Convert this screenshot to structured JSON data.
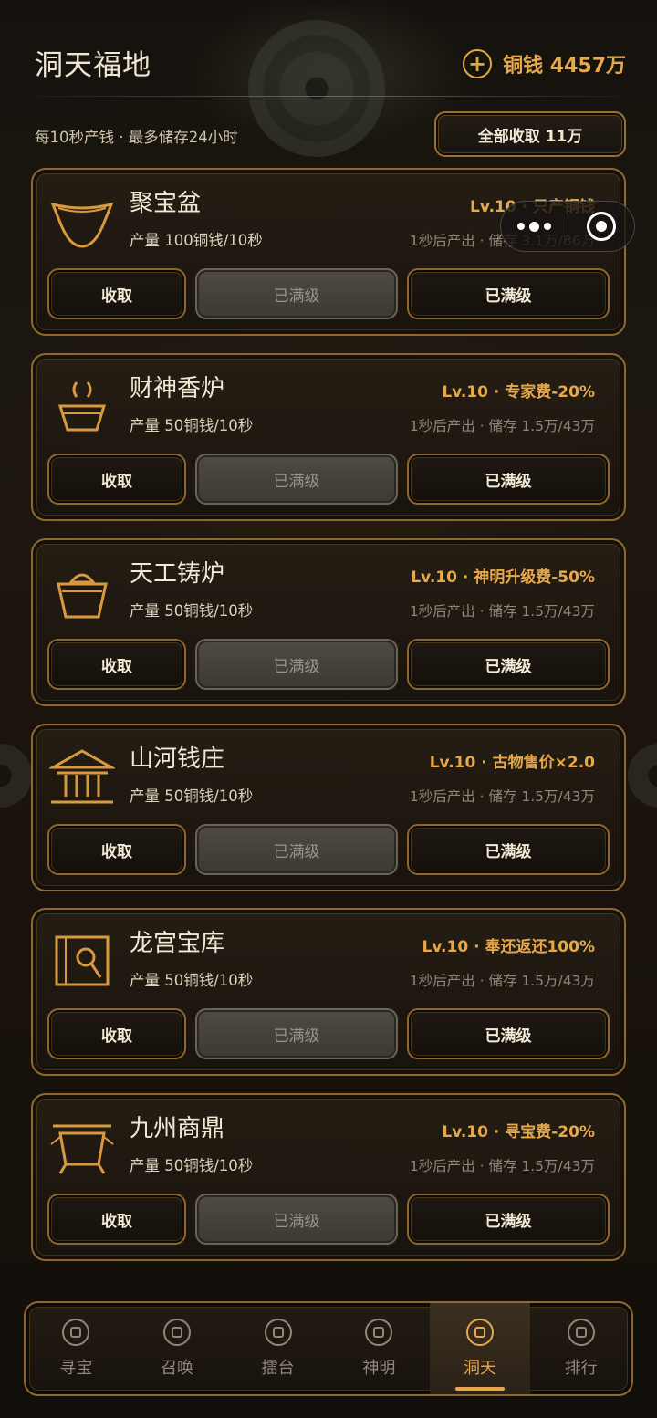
{
  "header": {
    "title": "洞天福地",
    "coins": "铜钱 4457万",
    "subtitle": "每10秒产钱 · 最多储存24小时",
    "collect_all_label": "全部收取 11万"
  },
  "cards": [
    {
      "name": "聚宝盆",
      "output": "产量 100铜钱/10秒",
      "level": "Lv.10 · 只产铜钱",
      "storage": "1秒后产出 · 储存 3.1万/86万",
      "icon": "treasure-bowl-icon"
    },
    {
      "name": "财神香炉",
      "output": "产量 50铜钱/10秒",
      "level": "Lv.10 · 专家费-20%",
      "storage": "1秒后产出 · 储存 1.5万/43万",
      "icon": "incense-burner-icon"
    },
    {
      "name": "天工铸炉",
      "output": "产量 50铜钱/10秒",
      "level": "Lv.10 · 神明升级费-50%",
      "storage": "1秒后产出 · 储存 1.5万/43万",
      "icon": "forge-icon"
    },
    {
      "name": "山河钱庄",
      "output": "产量 50铜钱/10秒",
      "level": "Lv.10 · 古物售价×2.0",
      "storage": "1秒后产出 · 储存 1.5万/43万",
      "icon": "bank-icon"
    },
    {
      "name": "龙宫宝库",
      "output": "产量 50铜钱/10秒",
      "level": "Lv.10 · 奉还返还100%",
      "storage": "1秒后产出 · 储存 1.5万/43万",
      "icon": "vault-icon"
    },
    {
      "name": "九州商鼎",
      "output": "产量 50铜钱/10秒",
      "level": "Lv.10 · 寻宝费-20%",
      "storage": "1秒后产出 · 储存 1.5万/43万",
      "icon": "cauldron-icon"
    }
  ],
  "buttons": {
    "collect": "收取",
    "maxed": "已满级"
  },
  "nav": [
    {
      "label": "寻宝",
      "icon": "treasure-hunt-icon",
      "active": false
    },
    {
      "label": "召唤",
      "icon": "summon-icon",
      "active": false
    },
    {
      "label": "擂台",
      "icon": "arena-icon",
      "active": false
    },
    {
      "label": "神明",
      "icon": "deity-icon",
      "active": false
    },
    {
      "label": "洞天",
      "icon": "cave-home-icon",
      "active": true
    },
    {
      "label": "排行",
      "icon": "ranking-icon",
      "active": false
    }
  ],
  "colors": {
    "accent": "#e6a84a",
    "border": "#8f6830",
    "text": "#f1e8d6",
    "muted": "#8f877a"
  }
}
